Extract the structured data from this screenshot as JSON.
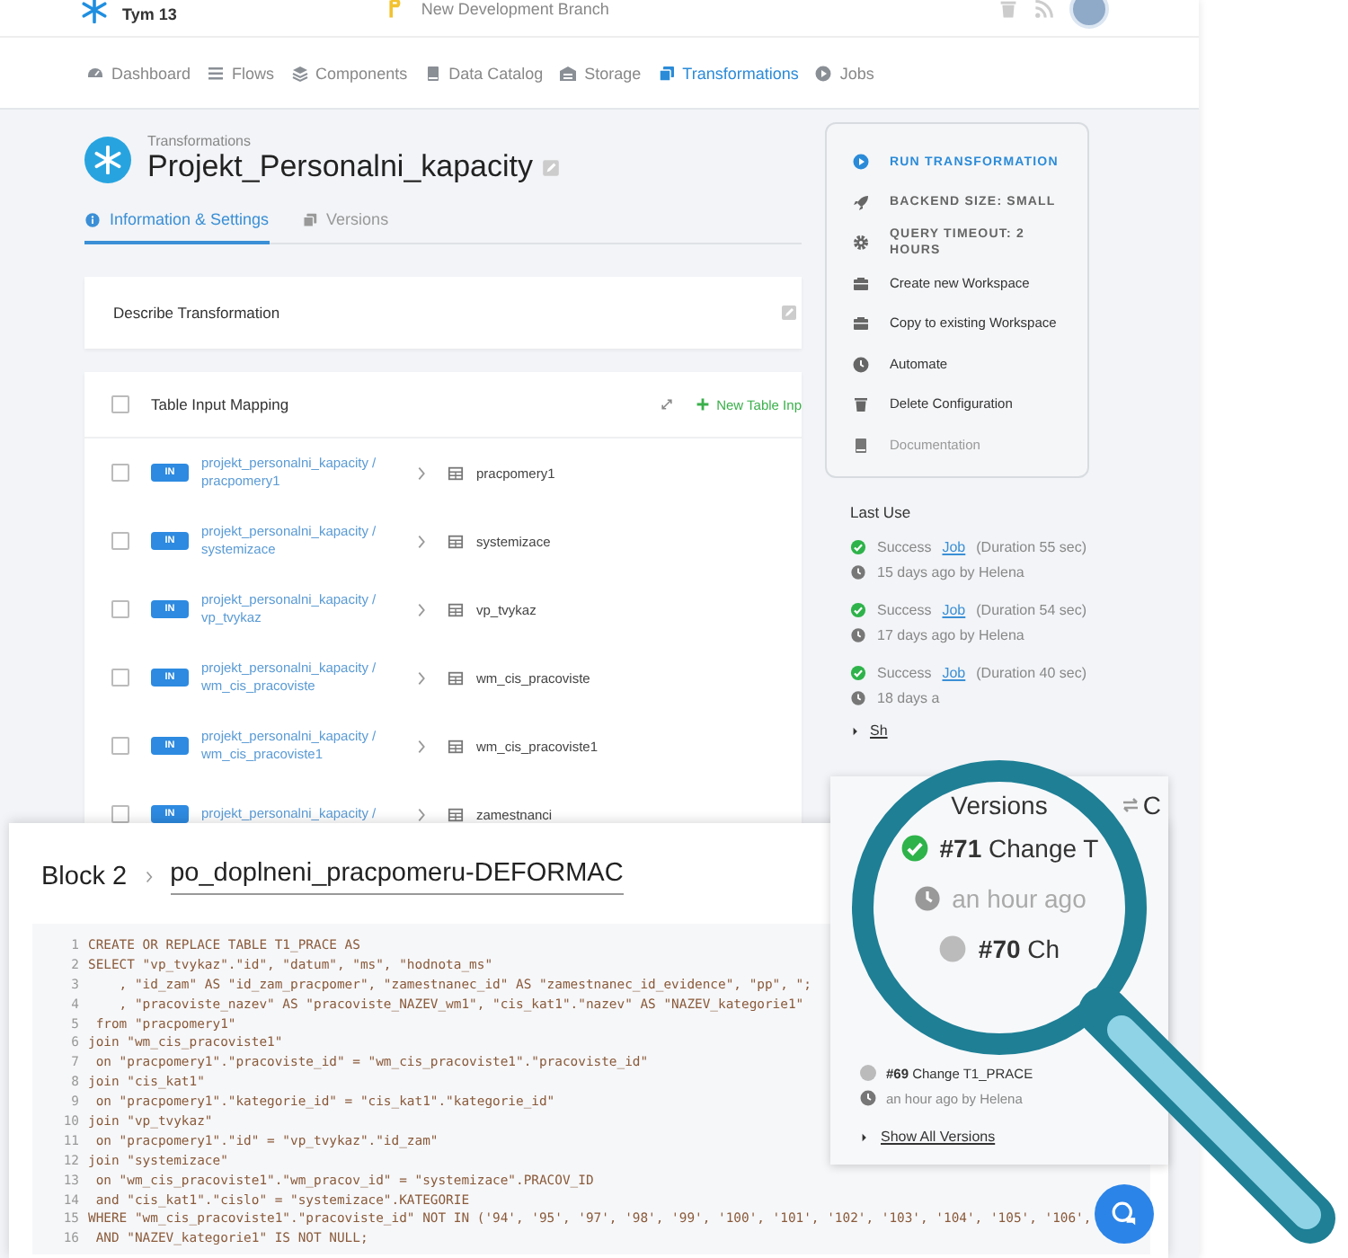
{
  "top_bar": {
    "team": "Tym 13",
    "branch": "New Development Branch"
  },
  "nav": [
    {
      "label": "Dashboard",
      "selected": false
    },
    {
      "label": "Flows",
      "selected": false
    },
    {
      "label": "Components",
      "selected": false
    },
    {
      "label": "Data Catalog",
      "selected": false
    },
    {
      "label": "Storage",
      "selected": false
    },
    {
      "label": "Transformations",
      "selected": true
    },
    {
      "label": "Jobs",
      "selected": false
    }
  ],
  "header": {
    "breadcrumb": "Transformations",
    "title": "Projekt_Personalni_kapacity"
  },
  "tabs": [
    {
      "label": "Information & Settings",
      "selected": true
    },
    {
      "label": "Versions",
      "selected": false
    }
  ],
  "description": {
    "label": "Describe Transformation"
  },
  "input_mapping": {
    "title": "Table Input Mapping",
    "checked": false,
    "add_button": "New Table Inp",
    "rows": [
      {
        "checked": false,
        "badge": "IN",
        "source": "projekt_personalni_kapacity / pracpomery1",
        "target": "pracpomery1"
      },
      {
        "checked": false,
        "badge": "IN",
        "source": "projekt_personalni_kapacity / systemizace",
        "target": "systemizace"
      },
      {
        "checked": false,
        "badge": "IN",
        "source": "projekt_personalni_kapacity / vp_tvykaz",
        "target": "vp_tvykaz"
      },
      {
        "checked": false,
        "badge": "IN",
        "source": "projekt_personalni_kapacity / wm_cis_pracoviste",
        "target": "wm_cis_pracoviste"
      },
      {
        "checked": false,
        "badge": "IN",
        "source": "projekt_personalni_kapacity / wm_cis_pracoviste1",
        "target": "wm_cis_pracoviste1"
      },
      {
        "checked": false,
        "badge": "IN",
        "source": "projekt_personalni_kapacity /",
        "target": "zamestnanci"
      }
    ]
  },
  "actions": [
    {
      "label": "RUN TRANSFORMATION",
      "kind": "primary"
    },
    {
      "label": "BACKEND SIZE: SMALL",
      "kind": "setting"
    },
    {
      "label": "QUERY TIMEOUT: 2 HOURS",
      "kind": "setting"
    },
    {
      "label": "Create new Workspace",
      "kind": "action"
    },
    {
      "label": "Copy to existing Workspace",
      "kind": "action"
    },
    {
      "label": "Automate",
      "kind": "action"
    },
    {
      "label": "Delete Configuration",
      "kind": "action"
    },
    {
      "label": "Documentation",
      "kind": "muted"
    }
  ],
  "last_use": {
    "title": "Last Use",
    "entries": [
      {
        "status": "Success",
        "link": "Job",
        "duration": "(Duration 55 sec)",
        "time": "15 days ago by Helena"
      },
      {
        "status": "Success",
        "link": "Job",
        "duration": "(Duration 54 sec)",
        "time": "17 days ago by Helena"
      },
      {
        "status": "Success",
        "link": "Job",
        "duration": "(Duration 40 sec)",
        "time": "18 days a"
      }
    ],
    "more": "Sh"
  },
  "versions": {
    "title": "Versions",
    "compare": "C",
    "items": [
      {
        "kind": "magnified",
        "number": "#71",
        "title": "Change T",
        "time": "an hour ago",
        "current": true
      },
      {
        "kind": "magnified",
        "number": "#70",
        "title": "Ch",
        "current": false
      },
      {
        "kind": "normal",
        "number": "#69",
        "title": "Change T1_PRACE",
        "time": "an hour ago by Helena",
        "current": false
      }
    ],
    "show_all": "Show All Versions"
  },
  "code_panel": {
    "block": "Block 2",
    "name": "po_doplneni_pracpomeru-DEFORMAC",
    "lines": [
      {
        "number": "1",
        "code": "CREATE OR REPLACE TABLE T1_PRACE AS"
      },
      {
        "number": "2",
        "code": "SELECT \"vp_tvykaz\".\"id\", \"datum\", \"ms\", \"hodnota_ms\""
      },
      {
        "number": "3",
        "code": "    , \"id_zam\" AS \"id_zam_pracpomer\", \"zamestnanec_id\" AS \"zamestnanec_id_evidence\", \"pp\", \";"
      },
      {
        "number": "4",
        "code": "    , \"pracoviste_nazev\" AS \"pracoviste_NAZEV_wm1\", \"cis_kat1\".\"nazev\" AS \"NAZEV_kategorie1\""
      },
      {
        "number": "5",
        "code": " from \"pracpomery1\""
      },
      {
        "number": "6",
        "code": "join \"wm_cis_pracoviste1\""
      },
      {
        "number": "7",
        "code": " on \"pracpomery1\".\"pracoviste_id\" = \"wm_cis_pracoviste1\".\"pracoviste_id\""
      },
      {
        "number": "8",
        "code": "join \"cis_kat1\""
      },
      {
        "number": "9",
        "code": " on \"pracpomery1\".\"kategorie_id\" = \"cis_kat1\".\"kategorie_id\""
      },
      {
        "number": "10",
        "code": "join \"vp_tvykaz\""
      },
      {
        "number": "11",
        "code": " on \"pracpomery1\".\"id\" = \"vp_tvykaz\".\"id_zam\""
      },
      {
        "number": "12",
        "code": "join \"systemizace\""
      },
      {
        "number": "13",
        "code": " on \"wm_cis_pracoviste1\".\"wm_pracov_id\" = \"systemizace\".PRACOV_ID"
      },
      {
        "number": "14",
        "code": " and \"cis_kat1\".\"cislo\" = \"systemizace\".KATEGORIE"
      },
      {
        "number": "15",
        "code": "WHERE \"wm_cis_pracoviste1\".\"pracoviste_id\" NOT IN ('94', '95', '97', '98', '99', '100', '101', '102', '103', '104', '105', '106',"
      },
      {
        "number": "16",
        "code": " AND \"NAZEV_kategorie1\" IS NOT NULL;"
      }
    ]
  }
}
